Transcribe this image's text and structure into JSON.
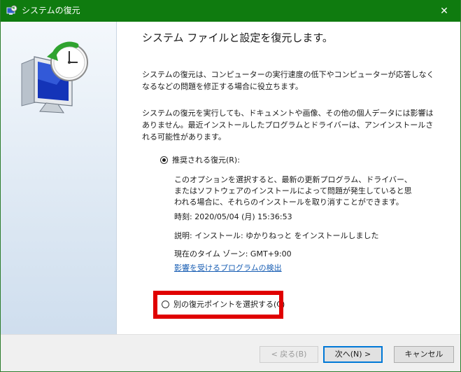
{
  "window": {
    "title": "システムの復元",
    "close_glyph": "✕",
    "titlebar_color": "#0f7b0f"
  },
  "content": {
    "heading": "システム ファイルと設定を復元します。",
    "para1": "システムの復元は、コンピューターの実行速度の低下やコンピューターが応答しなくなるなどの問題を修正する場合に役立ちます。",
    "para2": "システムの復元を実行しても、ドキュメントや画像、その他の個人データには影響はありません。最近インストールしたプログラムとドライバーは、アンインストールされる可能性があります。",
    "recommended": {
      "label": "推奨される復元(R):",
      "checked": true,
      "description": "このオプションを選択すると、最新の更新プログラム、ドライバー、またはソフトウェアのインストールによって問題が発生していると思われる場合に、それらのインストールを取り消すことができます。",
      "time": "時刻: 2020/05/04 (月) 15:36:53",
      "explanation": "説明: インストール: ゆかりねっと をインストールしました",
      "timezone": "現在のタイム ゾーン: GMT+9:00",
      "affected_link": "影響を受けるプログラムの検出"
    },
    "other": {
      "label": "別の復元ポイントを選択する(C)",
      "checked": false,
      "highlight_color": "#e00000"
    }
  },
  "footer": {
    "back_label": "< 戻る(B)",
    "next_label": "次へ(N) >",
    "cancel_label": "キャンセル"
  }
}
